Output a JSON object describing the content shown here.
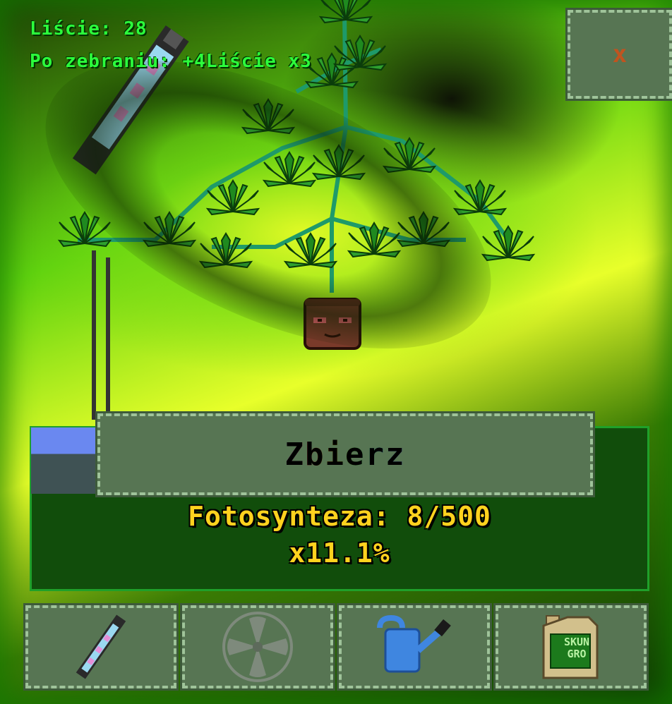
{
  "hud": {
    "leaves_label": "Liście: 28",
    "after_harvest_label": "Po zebraniu: +4Liście x3"
  },
  "close_button": {
    "label": "x"
  },
  "harvest_button": {
    "label": "Zbierz"
  },
  "status": {
    "photosynthesis_label": "Fotosynteza: 8/500",
    "multiplier_label": "x11.1%"
  },
  "toolbar": {
    "items": [
      {
        "icon": "lamp-icon"
      },
      {
        "icon": "fan-icon"
      },
      {
        "icon": "watering-can-icon"
      },
      {
        "icon": "fertilizer-icon",
        "label": "SKUN GRO"
      }
    ]
  },
  "colors": {
    "hud_text": "#2cff3c",
    "panel": "#577553",
    "panel_border": "#9fc39a",
    "status_text": "#ffd21e",
    "close_x": "#c0541f"
  }
}
